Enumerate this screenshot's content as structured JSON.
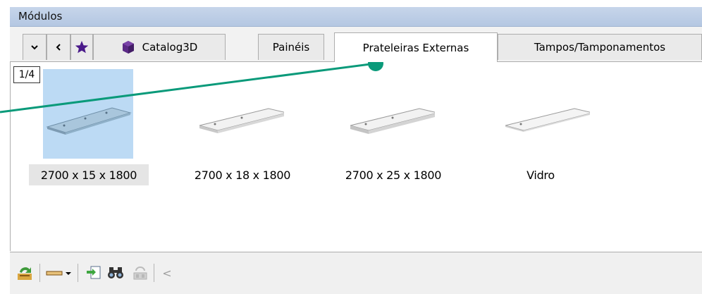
{
  "window": {
    "title": "Módulos"
  },
  "tabs": {
    "nav": [
      "⌄",
      "<"
    ],
    "items": [
      {
        "label": "Catalog3D"
      },
      {
        "label": "Painéis"
      },
      {
        "label": "Prateleiras Externas",
        "active": true
      },
      {
        "label": "Tampos/Tamponamentos"
      }
    ]
  },
  "content": {
    "page_indicator": "1/4",
    "items": [
      {
        "label": "2700 x 15 x 1800",
        "selected": true
      },
      {
        "label": "2700 x 18 x 1800"
      },
      {
        "label": "2700 x 25 x 1800"
      },
      {
        "label": "Vidro"
      }
    ]
  },
  "toolbar": {
    "scroll_label": "<"
  },
  "colors": {
    "callout": "#0a9a7a",
    "title_bar": "#b9cbe4",
    "selection": "#bcdaf4",
    "favorite_star": "#4a1a8a"
  }
}
